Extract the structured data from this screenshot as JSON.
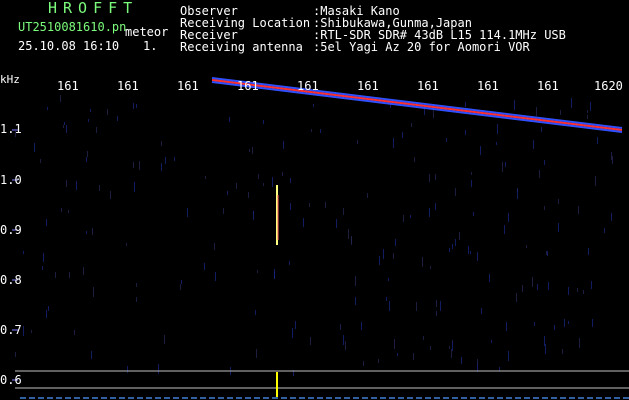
{
  "header": {
    "title": "HROFFT",
    "filename": "UT2510081610.pn",
    "meteor_label": "meteor",
    "datetime": "25.10.08 16:10",
    "count": "1."
  },
  "info": {
    "observer_label": "Observer",
    "observer_value": ":Masaki Kano",
    "location_label": "Receiving Location",
    "location_value": ":Shibukawa,Gunma,Japan",
    "receiver_label": "Receiver",
    "receiver_value": ":RTL-SDR SDR# 43dB L15 114.1MHz USB",
    "antenna_label": "Receiving antenna",
    "antenna_value": ":5el Yagi Az 20 for Aomori VOR"
  },
  "chart_data": {
    "type": "spectrogram",
    "ylabel": "kHz",
    "x_tick_labels": [
      "161",
      "161",
      "161",
      "161",
      "161",
      "161",
      "161",
      "161",
      "161",
      "1620"
    ],
    "y_tick_labels": [
      "1.1",
      "1.0",
      "0.9",
      "0.8",
      "0.7",
      "0.6"
    ],
    "y_ticks": [
      1.1,
      1.0,
      0.9,
      0.8,
      0.7,
      0.6
    ],
    "ylim": [
      0.6,
      1.1
    ],
    "carrier_trace": {
      "x_start_min": 0.0,
      "x_end_min": 10.0,
      "start_khz": 1.2,
      "end_khz": 1.1
    },
    "meteor_echo": {
      "x_min": 4.5,
      "khz_top": 0.99,
      "khz_bottom": 0.87
    },
    "colors": {
      "background": "#000000",
      "text_green": "#7CFC7C",
      "text_white": "#ffffff",
      "trace_hot": "#ff3030",
      "trace_cool": "#3050ff",
      "echo": "#ffff80",
      "baseline": "#ffff00"
    }
  }
}
